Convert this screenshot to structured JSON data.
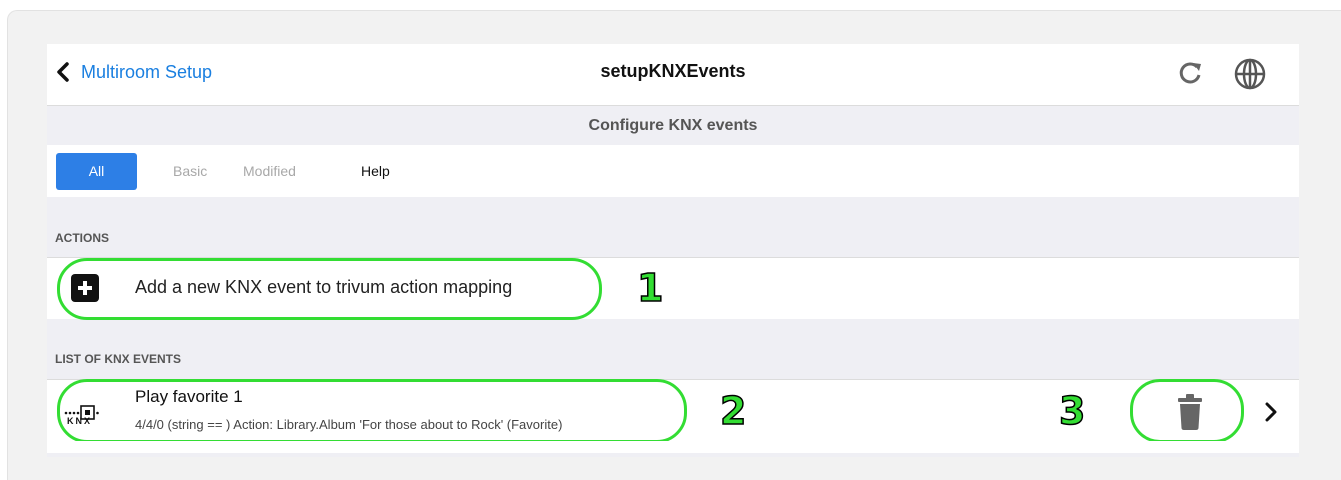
{
  "navbar": {
    "back_label": "Multiroom Setup",
    "title": "setupKNXEvents",
    "icons": [
      "chevron-left-icon",
      "reload-icon",
      "globe-icon"
    ]
  },
  "subtitle": "Configure KNX events",
  "tabs": [
    {
      "label": "All",
      "active": true
    },
    {
      "label": "Basic",
      "active": false
    },
    {
      "label": "Modified",
      "active": false
    },
    {
      "label": "Help",
      "active": false
    }
  ],
  "sections": {
    "actions": {
      "header": "ACTIONS",
      "items": [
        {
          "label": "Add a new KNX event to trivum action mapping",
          "icon": "plus-square-icon"
        }
      ]
    },
    "events": {
      "header": "LIST OF KNX EVENTS",
      "items": [
        {
          "icon": "knx-logo-icon",
          "title": "Play favorite 1",
          "description": "4/4/0 (string == ) Action: Library.Album 'For those about to Rock' (Favorite)"
        }
      ]
    }
  },
  "callouts": [
    "1",
    "2",
    "3"
  ],
  "colors": {
    "accent": "#2d7fe6",
    "link": "#1a7fe0",
    "highlight": "#33dd33"
  }
}
